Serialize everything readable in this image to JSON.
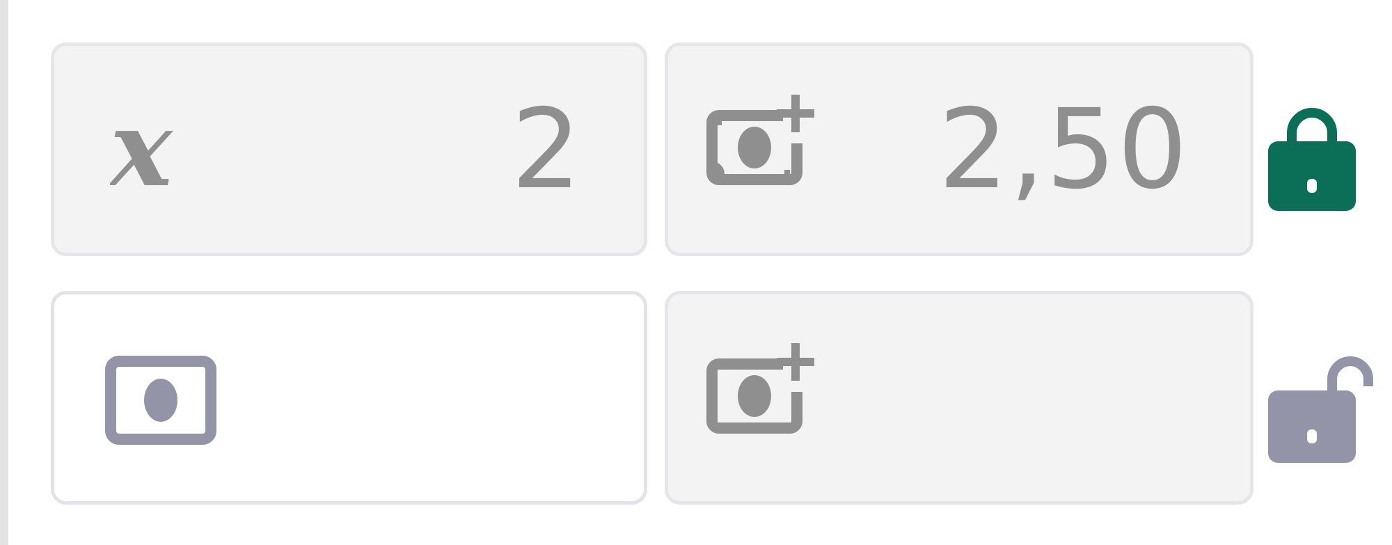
{
  "rows": [
    {
      "quantity": {
        "icon": "multiply-x-icon",
        "value": "2"
      },
      "unit_price": {
        "icon": "money-add-icon",
        "value": "2,50"
      },
      "lock": {
        "icon": "lock-closed-icon",
        "state": "locked",
        "color": "#0b6e57"
      }
    },
    {
      "price": {
        "icon": "money-icon",
        "value": ""
      },
      "unit_price": {
        "icon": "money-add-icon",
        "value": ""
      },
      "lock": {
        "icon": "lock-open-icon",
        "state": "unlocked",
        "color": "#9394a8"
      }
    }
  ],
  "colors": {
    "field_bg": "#f3f3f3",
    "field_border": "#e6e6e9",
    "text_muted": "#8f8f8f",
    "icon_gray": "#8f8f8f",
    "icon_purple_gray": "#9394a8",
    "lock_green": "#0b6e57"
  }
}
